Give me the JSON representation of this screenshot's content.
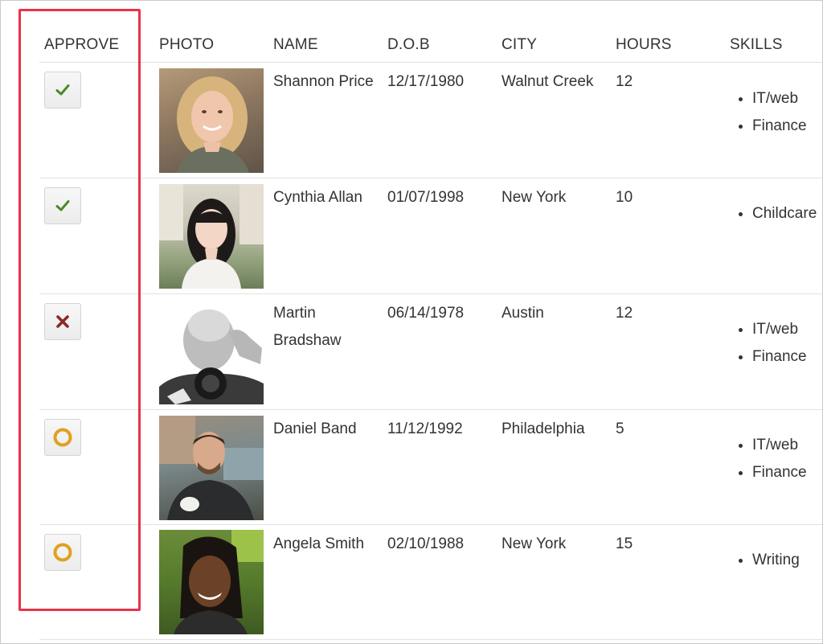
{
  "columns": {
    "approve": "APPROVE",
    "photo": "PHOTO",
    "name": "NAME",
    "dob": "D.O.B",
    "city": "CITY",
    "hours": "HOURS",
    "skills": "SKILLS"
  },
  "colors": {
    "highlight": "#e8334a",
    "approved": "#4a8a2a",
    "rejected": "#8b2a2a",
    "pending": "#e0a020"
  },
  "rows": [
    {
      "status": "approved",
      "status_icon": "check-icon",
      "name": "Shannon Price",
      "dob": "12/17/1980",
      "city": "Walnut Creek",
      "hours": "12",
      "skills": [
        "IT/web",
        "Finance"
      ]
    },
    {
      "status": "approved",
      "status_icon": "check-icon",
      "name": "Cynthia Allan",
      "dob": "01/07/1998",
      "city": "New York",
      "hours": "10",
      "skills": [
        "Childcare"
      ]
    },
    {
      "status": "rejected",
      "status_icon": "cross-icon",
      "name": "Martin Bradshaw",
      "dob": "06/14/1978",
      "city": "Austin",
      "hours": "12",
      "skills": [
        "IT/web",
        "Finance"
      ]
    },
    {
      "status": "pending",
      "status_icon": "circle-icon",
      "name": "Daniel Band",
      "dob": "11/12/1992",
      "city": "Philadelphia",
      "hours": "5",
      "skills": [
        "IT/web",
        "Finance"
      ]
    },
    {
      "status": "pending",
      "status_icon": "circle-icon",
      "name": "Angela Smith",
      "dob": "02/10/1988",
      "city": "New York",
      "hours": "15",
      "skills": [
        "Writing"
      ]
    }
  ]
}
